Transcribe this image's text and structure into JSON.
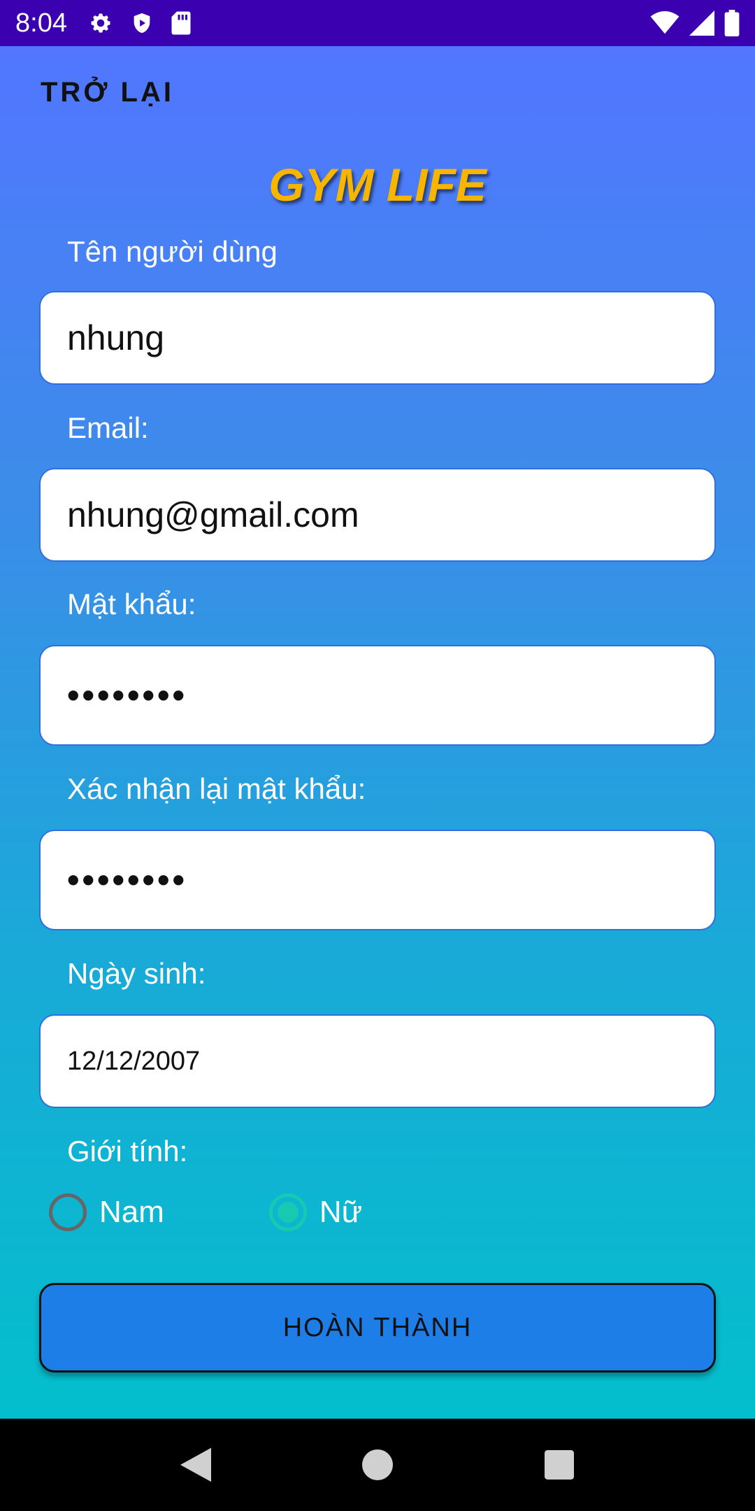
{
  "status_bar": {
    "time": "8:04",
    "icons_left": [
      "settings-icon",
      "shield-play-icon",
      "sd-card-icon"
    ],
    "icons_right": [
      "wifi-icon",
      "signal-icon",
      "battery-icon"
    ],
    "background": "#3b00b0"
  },
  "header": {
    "back_label": "TRỞ LẠI",
    "app_title": "GYM LIFE",
    "title_color": "#f7b500"
  },
  "form": {
    "username": {
      "label": "Tên người dùng",
      "value": "nhung"
    },
    "email": {
      "label": "Email:",
      "value": "nhung@gmail.com"
    },
    "password": {
      "label": "Mật khẩu:",
      "value": "••••••••"
    },
    "confirm_password": {
      "label": "Xác nhận lại mật khẩu:",
      "value": "••••••••"
    },
    "birthday": {
      "label": "Ngày sinh:",
      "value": "12/12/2007"
    },
    "gender": {
      "label": "Giới tính:",
      "options": [
        {
          "label": "Nam",
          "selected": false
        },
        {
          "label": "Nữ",
          "selected": true
        }
      ]
    },
    "submit_label": "HOÀN THÀNH"
  },
  "nav_bar": {
    "buttons": [
      "back-icon",
      "home-icon",
      "recents-icon"
    ]
  },
  "colors": {
    "accent": "#1e7ee8",
    "radio_checked": "#16c9b0",
    "gradient_top": "#5276ff",
    "gradient_bottom": "#03bfcc"
  }
}
